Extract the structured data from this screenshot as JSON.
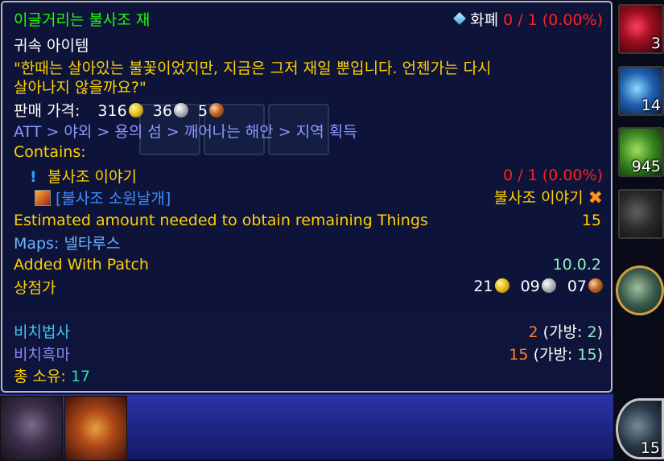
{
  "item": {
    "name": "이글거리는 불사조 재",
    "currency_label": "화폐",
    "currency_progress": "0 / 1 (0.00%)",
    "binding": "귀속 아이템",
    "flavor_line1": "\"한때는 살아있는 불꽃이었지만, 지금은 그저 재일 뿐입니다. 언젠가는 다시",
    "flavor_line2": "살아나지 않을까요?\"",
    "sell_label": "판매 가격:",
    "sell_gold": "316",
    "sell_silver": "36",
    "sell_copper": "5"
  },
  "att": {
    "path": "ATT > 야외 > 용의 섬 > 깨어나는 해안 > 지역 획득",
    "contains_label": "Contains:",
    "quest_icon": "!",
    "quest_name": "불사조 이야기",
    "quest_progress": "0 / 1 (0.00%)",
    "reward_name": "[불사조 소원날개]",
    "reward_source": "불사조 이야기",
    "estimated_label": "Estimated amount needed to obtain remaining Things",
    "estimated_value": "15",
    "maps_label": "Maps: ",
    "maps_value": "넬타루스",
    "patch_label": "Added With Patch",
    "patch_value": "10.0.2"
  },
  "auction": {
    "label": "상점가",
    "gold": "21",
    "silver": "09",
    "copper": "07"
  },
  "characters": [
    {
      "name": "비치법사",
      "count": "2",
      "bag_label": "(가방:",
      "bag_count": "2",
      "close": ")"
    },
    {
      "name": "비치흑마",
      "count": "15",
      "bag_label": "(가방:",
      "bag_count": "15",
      "close": ")"
    }
  ],
  "total": {
    "label": "총 소유:",
    "value": "17"
  },
  "sidebar_counts": [
    "3",
    "14",
    "945",
    "15"
  ],
  "colors": {
    "uncommon_green": "#1eff00",
    "gold": "#ffd100",
    "red": "#ff2020",
    "mage": "#3fc7eb",
    "warlock": "#8788ee"
  },
  "icons": [
    "currency-diamond-icon",
    "gold-coin-icon",
    "silver-coin-icon",
    "copper-coin-icon",
    "quest-exclamation-icon",
    "reward-item-icon",
    "not-collected-x-icon"
  ]
}
